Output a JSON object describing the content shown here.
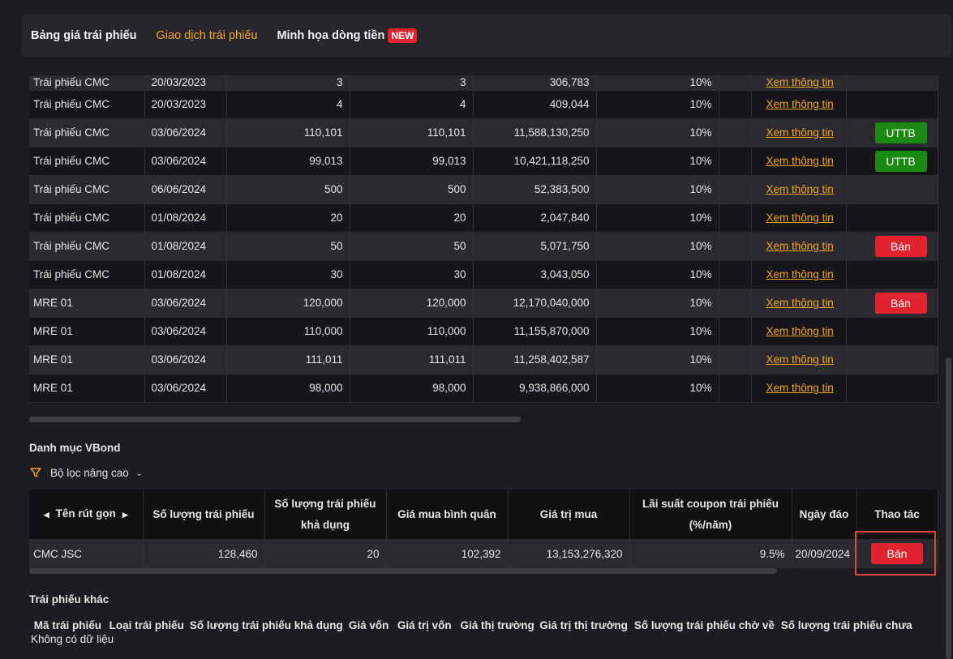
{
  "nav": {
    "tabs": [
      {
        "label": "Bảng giá trái phiếu"
      },
      {
        "label": "Giao dịch trái phiếu"
      },
      {
        "label": "Minh họa dòng tiền"
      }
    ],
    "new_badge": "NEW"
  },
  "upper_table": {
    "rows": [
      {
        "name": "Trái phiếu CMC",
        "date": "20/03/2023",
        "q1": "3",
        "q2": "3",
        "value": "306,783",
        "rate": "10%",
        "link": "Xem thông tin",
        "action": ""
      },
      {
        "name": "Trái phiếu CMC",
        "date": "20/03/2023",
        "q1": "4",
        "q2": "4",
        "value": "409,044",
        "rate": "10%",
        "link": "Xem thông tin",
        "action": ""
      },
      {
        "name": "Trái phiếu CMC",
        "date": "03/06/2024",
        "q1": "110,101",
        "q2": "110,101",
        "value": "11,588,130,250",
        "rate": "10%",
        "link": "Xem thông tin",
        "action": "UTTB"
      },
      {
        "name": "Trái phiếu CMC",
        "date": "03/06/2024",
        "q1": "99,013",
        "q2": "99,013",
        "value": "10,421,118,250",
        "rate": "10%",
        "link": "Xem thông tin",
        "action": "UTTB"
      },
      {
        "name": "Trái phiếu CMC",
        "date": "06/06/2024",
        "q1": "500",
        "q2": "500",
        "value": "52,383,500",
        "rate": "10%",
        "link": "Xem thông tin",
        "action": ""
      },
      {
        "name": "Trái phiếu CMC",
        "date": "01/08/2024",
        "q1": "20",
        "q2": "20",
        "value": "2,047,840",
        "rate": "10%",
        "link": "Xem thông tin",
        "action": ""
      },
      {
        "name": "Trái phiếu CMC",
        "date": "01/08/2024",
        "q1": "50",
        "q2": "50",
        "value": "5,071,750",
        "rate": "10%",
        "link": "Xem thông tin",
        "action": "Bán"
      },
      {
        "name": "Trái phiếu CMC",
        "date": "01/08/2024",
        "q1": "30",
        "q2": "30",
        "value": "3,043,050",
        "rate": "10%",
        "link": "Xem thông tin",
        "action": ""
      },
      {
        "name": "MRE 01",
        "date": "03/06/2024",
        "q1": "120,000",
        "q2": "120,000",
        "value": "12,170,040,000",
        "rate": "10%",
        "link": "Xem thông tin",
        "action": "Bán"
      },
      {
        "name": "MRE 01",
        "date": "03/06/2024",
        "q1": "110,000",
        "q2": "110,000",
        "value": "11,155,870,000",
        "rate": "10%",
        "link": "Xem thông tin",
        "action": ""
      },
      {
        "name": "MRE 01",
        "date": "03/06/2024",
        "q1": "111,011",
        "q2": "111,011",
        "value": "11,258,402,587",
        "rate": "10%",
        "link": "Xem thông tin",
        "action": ""
      },
      {
        "name": "MRE 01",
        "date": "03/06/2024",
        "q1": "98,000",
        "q2": "98,000",
        "value": "9,938,866,000",
        "rate": "10%",
        "link": "Xem thông tin",
        "action": ""
      }
    ]
  },
  "vbond": {
    "title": "Danh mục VBond",
    "filter_label": "Bộ lọc nâng cao",
    "headers": {
      "short_name": "Tên rút gọn",
      "quantity": "Số lượng trái phiếu",
      "available_l1": "Số lượng trái phiếu",
      "available_l2": "khả dụng",
      "avg_price": "Giá mua bình quân",
      "buy_value": "Giá trị mua",
      "coupon_l1": "Lãi suất coupon trái phiếu",
      "coupon_l2": "(%/năm)",
      "maturity": "Ngày đáo",
      "action": "Thao tác"
    },
    "row": {
      "short_name": "CMC JSC",
      "quantity": "128,460",
      "available": "20",
      "avg_price": "102,392",
      "buy_value": "13,153,276,320",
      "coupon": "9.5%",
      "maturity": "20/09/2024",
      "action": "Bán"
    }
  },
  "other_bonds": {
    "title": "Trái phiếu khác",
    "headers": [
      "Mã trái phiếu",
      "Loại trái phiếu",
      "Số lượng trái phiếu khả dụng",
      "Giá vốn",
      "Giá trị vốn",
      "Giá thị trường",
      "Giá trị thị trường",
      "Số lượng trái phiếu chờ về",
      "Số lượng trái phiếu chưa"
    ],
    "empty_text": "Không có dữ liệu"
  }
}
